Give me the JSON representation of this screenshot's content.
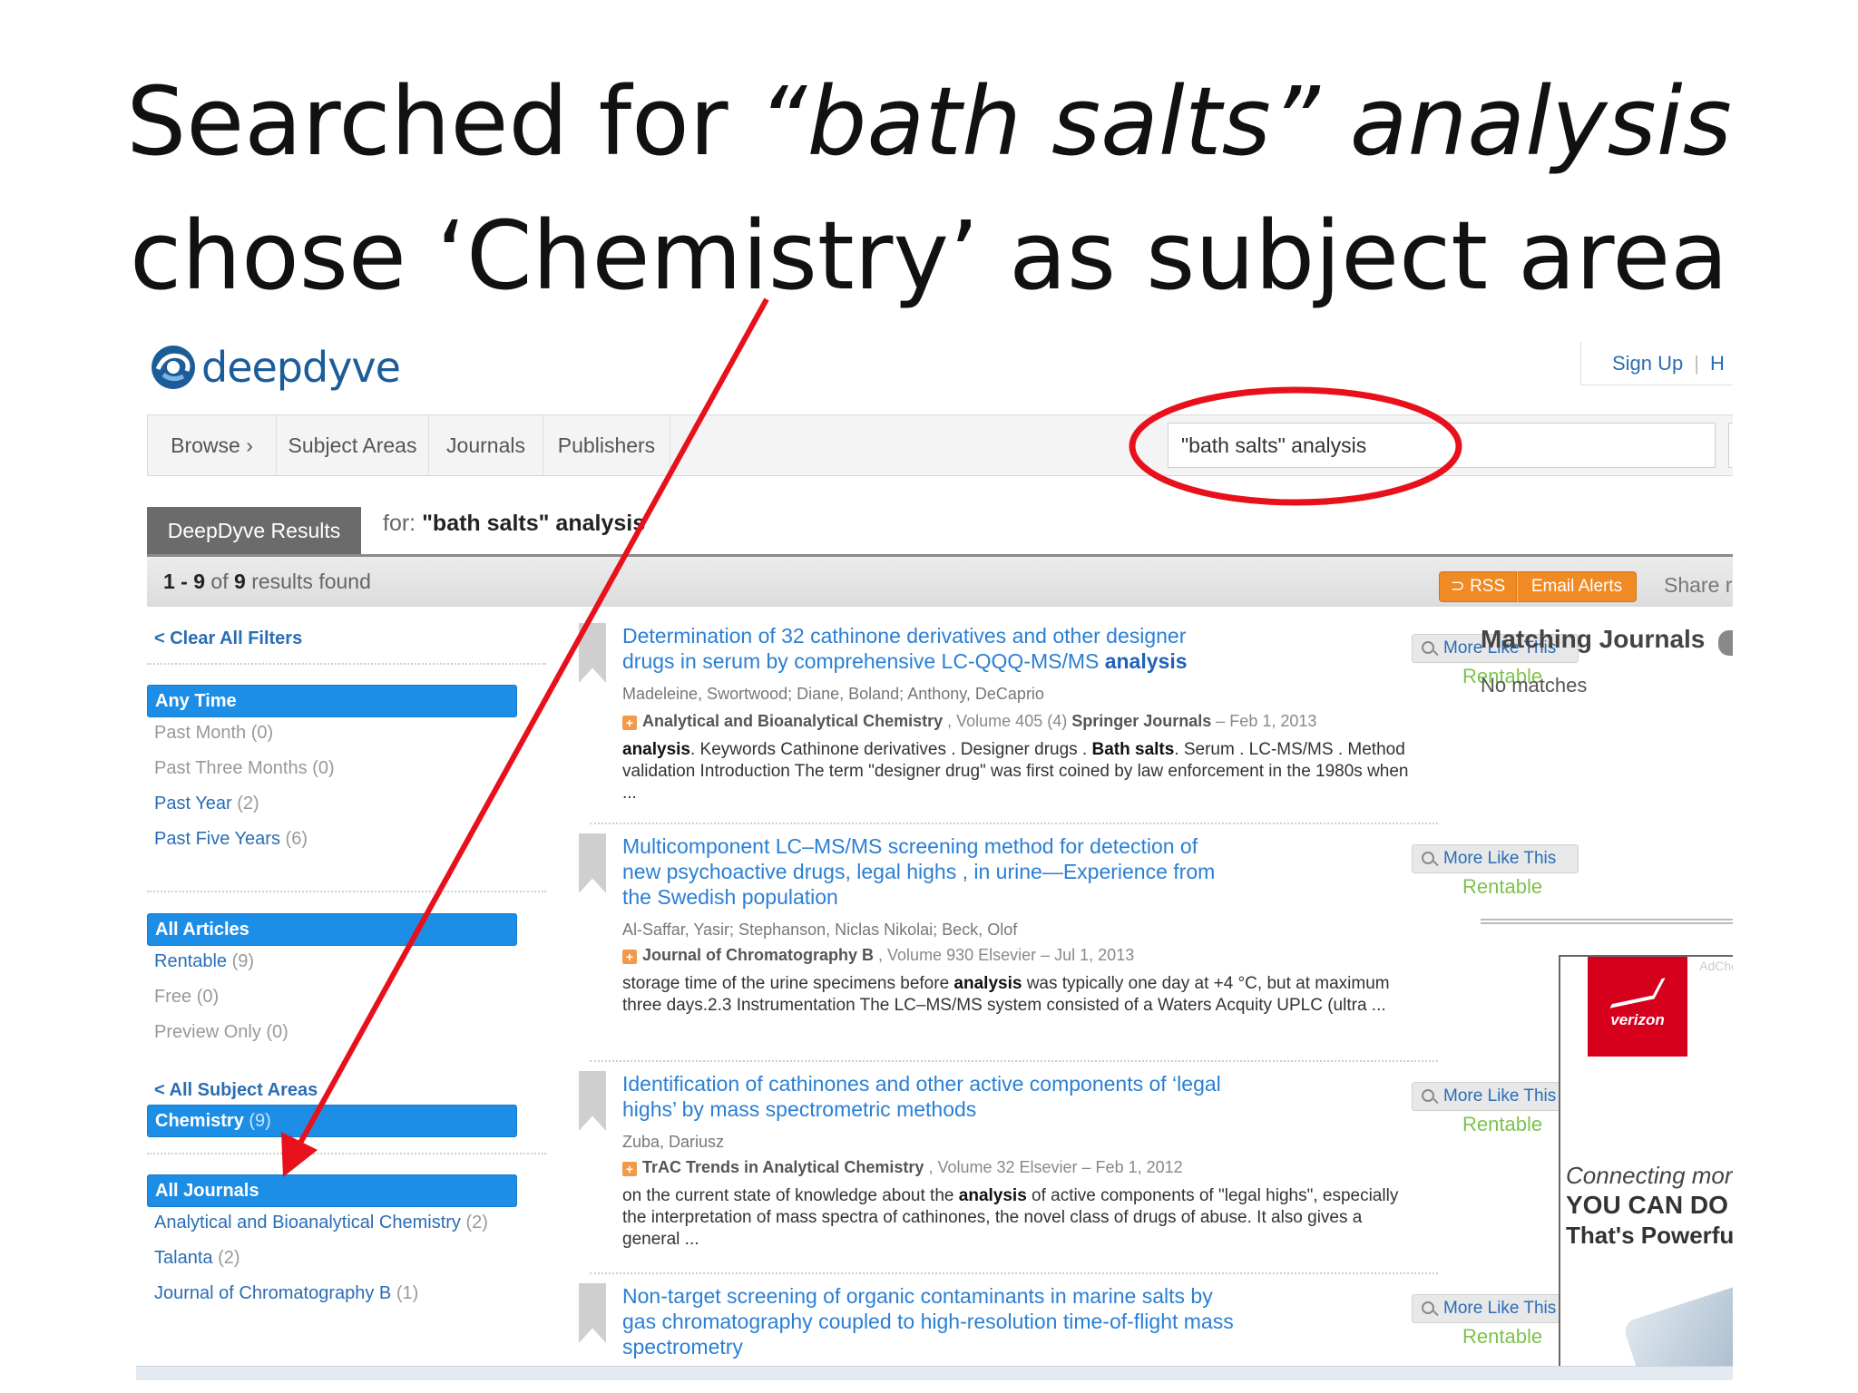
{
  "slide": {
    "title_line1_prefix": "Searched for ",
    "title_line1_query": "“bath salts” analysis",
    "title_line2": "chose ‘Chemistry’ as subject area"
  },
  "site": {
    "logo_text": "deepdyve",
    "sign_up": "Sign Up",
    "help_partial": "H"
  },
  "nav": {
    "items": [
      "Browse ›",
      "Subject Areas",
      "Journals",
      "Publishers"
    ],
    "search_value": "\"bath salts\" analysis"
  },
  "results_header": {
    "tab": "DeepDyve Results",
    "for_label": "for:",
    "for_query": "\"bath salts\" analysis",
    "count_range": "1 - 9",
    "count_of": "of",
    "count_total": "9",
    "count_suffix": "results found",
    "rss": "RSS",
    "email_alerts": "Email Alerts",
    "share": "Share re"
  },
  "sidebar": {
    "clear_filters": "< Clear All Filters",
    "time_head": "Any Time",
    "time_items": [
      {
        "label": "Past Month",
        "count": "(0)"
      },
      {
        "label": "Past Three Months",
        "count": "(0)"
      },
      {
        "label": "Past Year",
        "count": "(2)"
      },
      {
        "label": "Past Five Years",
        "count": "(6)"
      }
    ],
    "articles_head": "All Articles",
    "article_items": [
      {
        "label": "Rentable",
        "count": "(9)"
      },
      {
        "label": "Free",
        "count": "(0)"
      },
      {
        "label": "Preview Only",
        "count": "(0)"
      }
    ],
    "all_subjects": "< All Subject Areas",
    "subject_selected": "Chemistry",
    "subject_count": "(9)",
    "journals_head": "All Journals",
    "journal_items": [
      {
        "label": "Analytical and Bioanalytical Chemistry",
        "count": "(2)"
      },
      {
        "label": "Talanta",
        "count": "(2)"
      },
      {
        "label": "Journal of Chromatography B",
        "count": "(1)"
      }
    ]
  },
  "results": [
    {
      "title": "Determination of 32 cathinone derivatives and other designer drugs in serum by comprehensive LC-QQQ-MS/MS",
      "title_bold": "analysis",
      "authors": "Madeleine, Swortwood; Diane, Boland; Anthony, DeCaprio",
      "journal": "Analytical and Bioanalytical Chemistry",
      "meta": ", Volume 405 (4)",
      "publisher": "Springer Journals",
      "date": "– Feb 1, 2013",
      "snippet_b1": "analysis",
      "snippet_t1": ". Keywords Cathinone derivatives . Designer drugs .",
      "snippet_b2": "Bath salts",
      "snippet_t2": ". Serum . LC-MS/MS . Method validation Introduction The term \"designer drug\" was first coined by law enforcement in the 1980s when ...",
      "more_like_this": "More Like This",
      "rentable": "Rentable"
    },
    {
      "title": "Multicomponent LC–MS/MS screening method for detection of new psychoactive drugs, legal highs , in urine—Experience from the Swedish population",
      "authors": "Al-Saffar, Yasir; Stephanson, Niclas Nikolai; Beck, Olof",
      "journal": "Journal of Chromatography B",
      "meta": ", Volume 930 Elsevier",
      "date": "– Jul 1, 2013",
      "snippet_t0": "storage time of the urine specimens before",
      "snippet_b1": "analysis",
      "snippet_t1": "was typically one day at +4 °C, but at maximum three days.2.3 Instrumentation The LC–MS/MS system consisted of a Waters Acquity UPLC (ultra ...",
      "more_like_this": "More Like This",
      "rentable": "Rentable"
    },
    {
      "title": "Identification of cathinones and other active components of ‘legal highs’ by mass spectrometric methods",
      "authors": "Zuba, Dariusz",
      "journal": "TrAC Trends in Analytical Chemistry",
      "meta": ", Volume 32 Elsevier",
      "date": "– Feb 1, 2012",
      "snippet_t0": "on the current state of knowledge about the",
      "snippet_b1": "analysis",
      "snippet_t1": "of active components of \"legal highs\", especially the interpretation of mass spectra of cathinones, the novel class of drugs of abuse. It also gives a general ...",
      "more_like_this": "More Like This",
      "rentable": "Rentable"
    },
    {
      "title": "Non-target screening of organic contaminants in marine salts by gas chromatography coupled to high-resolution time-of-flight mass spectrometry",
      "more_like_this": "More Like This",
      "rentable": "Rentable"
    }
  ],
  "right_column": {
    "matching_journals": "Matching Journals",
    "no_matches": "No matches",
    "ad_choices": "AdCho",
    "ad_brand": "verizon",
    "ad_line1": "Connecting more",
    "ad_line2": "YOU CAN DO M",
    "ad_line3": "That's Powerful."
  },
  "colors": {
    "link_blue": "#2a7fd4",
    "filter_blue": "#1d8ee5",
    "rentable_green": "#7dc24b",
    "rss_orange": "#f08a24",
    "annotation_red": "#e8101a"
  }
}
